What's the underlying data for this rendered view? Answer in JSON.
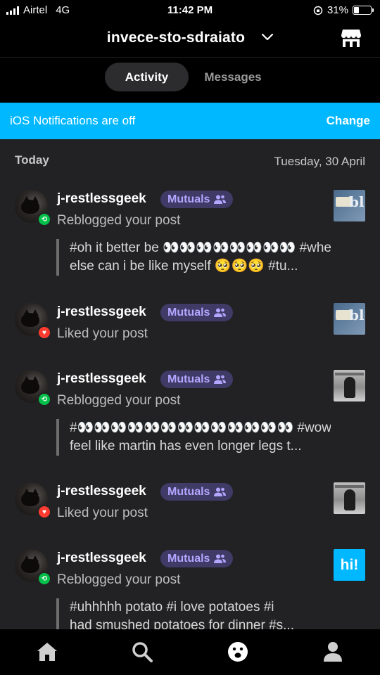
{
  "status_bar": {
    "carrier": "Airtel",
    "network": "4G",
    "time": "11:42 PM",
    "battery_percent": "31%",
    "battery_level": 0.31
  },
  "header": {
    "blog_name": "invece-sto-sdraiato",
    "chevron_icon": "chevron-down-icon",
    "shop_icon": "store-icon"
  },
  "tabs": [
    {
      "label": "Activity",
      "active": true
    },
    {
      "label": "Messages",
      "active": false
    }
  ],
  "banner": {
    "text": "iOS Notifications are off",
    "action": "Change",
    "color": "#00b8ff"
  },
  "feed": {
    "day_label": "Today",
    "date": "Tuesday, 30 April",
    "items": [
      {
        "username": "j-restlessgeek",
        "badge": "Mutuals",
        "type": "reblog",
        "action": "Reblogged your post",
        "quote_lines": [
          "#oh it better be 👀👀👀👀👀👀👀👀 #where",
          "else can i be like myself 🥺🥺🥺 #tu..."
        ],
        "thumb": "blog-card"
      },
      {
        "username": "j-restlessgeek",
        "badge": "Mutuals",
        "type": "like",
        "action": "Liked your post",
        "quote_lines": [],
        "thumb": "blog-card"
      },
      {
        "username": "j-restlessgeek",
        "badge": "Mutuals",
        "type": "reblog",
        "action": "Reblogged your post",
        "quote_lines": [
          "#👀👀👀👀👀👀👀👀👀👀👀👀👀 #wow #why do i",
          "feel like martin has even longer legs t..."
        ],
        "thumb": "photo"
      },
      {
        "username": "j-restlessgeek",
        "badge": "Mutuals",
        "type": "like",
        "action": "Liked your post",
        "quote_lines": [],
        "thumb": "photo"
      },
      {
        "username": "j-restlessgeek",
        "badge": "Mutuals",
        "type": "reblog",
        "action": "Reblogged your post",
        "quote_lines": [
          "#uhhhhh potato #i love potatoes #i",
          "had smushed potatoes for dinner #s..."
        ],
        "thumb": "hi",
        "thumb_text": "hi!"
      }
    ]
  },
  "bottom_nav": [
    {
      "name": "home-icon",
      "active": false
    },
    {
      "name": "search-icon",
      "active": false
    },
    {
      "name": "activity-icon",
      "active": true
    },
    {
      "name": "account-icon",
      "active": false
    }
  ],
  "colors": {
    "accent_blue": "#00b8ff",
    "mutuals_bg": "#3f3a66",
    "mutuals_text": "#b3a6ff",
    "reblog_green": "#03c04a",
    "like_red": "#ff3b30"
  }
}
